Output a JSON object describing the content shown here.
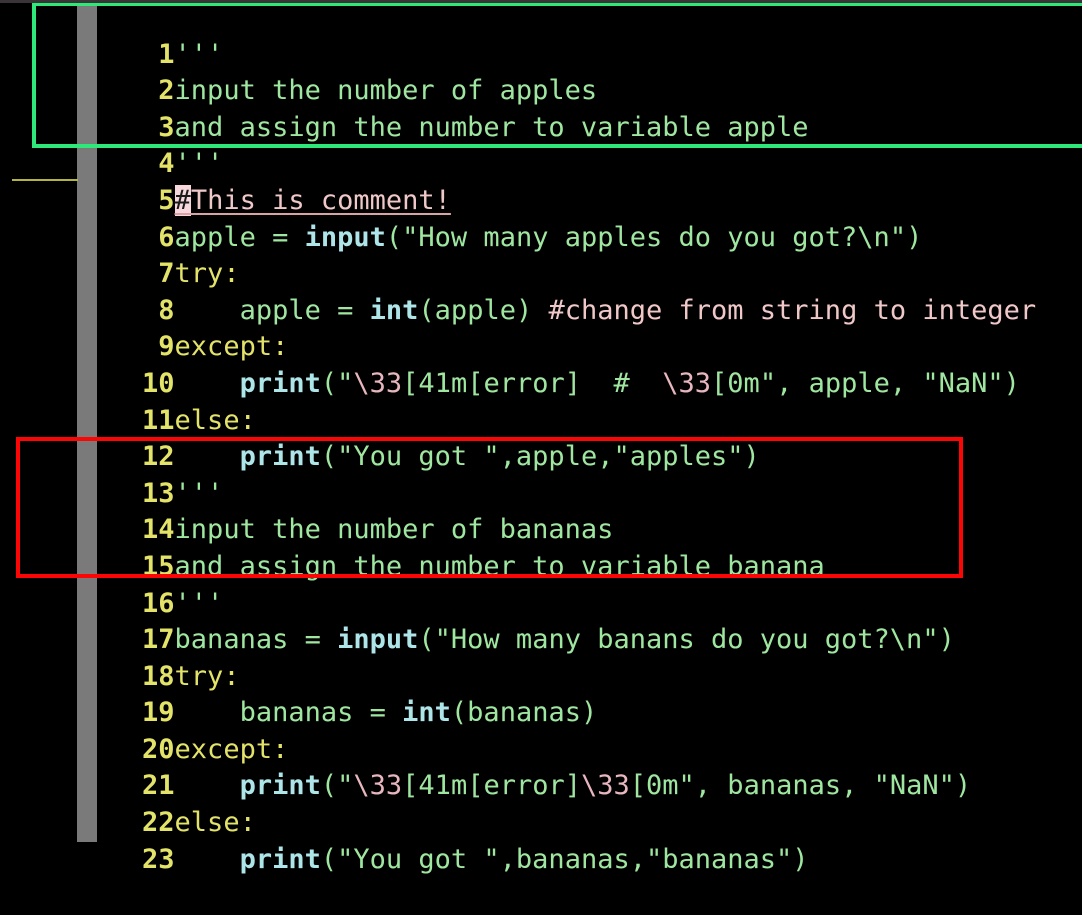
{
  "editor": {
    "language": "python",
    "background_color": "#000000",
    "line_number_color": "#e3e36a",
    "indent_guide_color": "#7a7a7a",
    "total_lines": 23
  },
  "annotations": [
    {
      "name": "green-highlight-box",
      "color": "#2ee87a",
      "covers_lines": "1-4",
      "label": "docstring-apples"
    },
    {
      "name": "red-highlight-box",
      "color": "#fb0505",
      "covers_lines": "13-16",
      "label": "docstring-bananas"
    }
  ],
  "lines": [
    {
      "num": "1",
      "text": "'''"
    },
    {
      "num": "2",
      "text": "input the number of apples"
    },
    {
      "num": "3",
      "text": "and assign the number to variable apple"
    },
    {
      "num": "4",
      "text": "'''"
    },
    {
      "num": "5",
      "text": "#This is comment!"
    },
    {
      "num": "6",
      "text": "apple = input(\"How many apples do you got?\\n\")"
    },
    {
      "num": "7",
      "text": "try:"
    },
    {
      "num": "8",
      "text": "    apple = int(apple) #change from string to integer"
    },
    {
      "num": "9",
      "text": "except:"
    },
    {
      "num": "10",
      "text": "    print(\"\\33[41m[error]  #  \\33[0m\", apple, \"NaN\")"
    },
    {
      "num": "11",
      "text": "else:"
    },
    {
      "num": "12",
      "text": "    print(\"You got \",apple,\"apples\")"
    },
    {
      "num": "13",
      "text": "'''"
    },
    {
      "num": "14",
      "text": "input the number of bananas"
    },
    {
      "num": "15",
      "text": "and assign the number to variable banana"
    },
    {
      "num": "16",
      "text": "'''"
    },
    {
      "num": "17",
      "text": "bananas = input(\"How many banans do you got?\\n\")"
    },
    {
      "num": "18",
      "text": "try:"
    },
    {
      "num": "19",
      "text": "    bananas = int(bananas)"
    },
    {
      "num": "20",
      "text": "except:"
    },
    {
      "num": "21",
      "text": "    print(\"\\33[41m[error]\\33[0m\", bananas, \"NaN\")"
    },
    {
      "num": "22",
      "text": "else:"
    },
    {
      "num": "23",
      "text": "    print(\"You got \",bananas,\"bananas\")"
    }
  ],
  "gutter": {
    "n1": "1",
    "n2": "2",
    "n3": "3",
    "n4": "4",
    "n5": "5",
    "n6": "6",
    "n7": "7",
    "n8": "8",
    "n9": "9",
    "n10": "10",
    "n11": "11",
    "n12": "12",
    "n13": "13",
    "n14": "14",
    "n15": "15",
    "n16": "16",
    "n17": "17",
    "n18": "18",
    "n19": "19",
    "n20": "20",
    "n21": "21",
    "n22": "22",
    "n23": "23"
  },
  "tokens": {
    "l1_quote": "'''",
    "l2_text": "input the number of apples",
    "l3_text": "and assign the number to variable apple",
    "l4_quote": "'''",
    "l5_hash": "#",
    "l5_text": "This is comment!",
    "l6_var": "apple ",
    "l6_eq": "= ",
    "l6_fn": "input",
    "l6_open": "(",
    "l6_str": "\"How many apples do you got?\\n\"",
    "l6_close": ")",
    "l7_kw": "try:",
    "l8_indent": "    ",
    "l8_var": "apple ",
    "l8_eq": "= ",
    "l8_fn": "int",
    "l8_args": "(apple) ",
    "l8_comment": "#change from string to integer",
    "l9_kw": "except:",
    "l10_indent": "    ",
    "l10_fn": "print",
    "l10_open": "(",
    "l10_q1": "\"",
    "l10_esc1": "\\33",
    "l10_mid": "[41m[error]  #  ",
    "l10_esc2": "\\33",
    "l10_tail": "[0m\"",
    "l10_rest": ", apple, \"NaN\")",
    "l11_kw": "else:",
    "l12_indent": "    ",
    "l12_fn": "print",
    "l12_rest": "(\"You got \",apple,\"apples\")",
    "l13_quote": "'''",
    "l14_text": "input the number of bananas",
    "l15_text": "and assign the number to variable banana",
    "l16_quote": "'''",
    "l17_var": "bananas ",
    "l17_eq": "= ",
    "l17_fn": "input",
    "l17_open": "(",
    "l17_str": "\"How many banans do you got?\\n\"",
    "l17_close": ")",
    "l18_kw": "try:",
    "l19_indent": "    ",
    "l19_var": "bananas ",
    "l19_eq": "= ",
    "l19_fn": "int",
    "l19_args": "(bananas)",
    "l20_kw": "except:",
    "l21_indent": "    ",
    "l21_fn": "print",
    "l21_open": "(",
    "l21_q1": "\"",
    "l21_esc1": "\\33",
    "l21_mid": "[41m[error]",
    "l21_esc2": "\\33",
    "l21_tail": "[0m\"",
    "l21_rest": ", bananas, \"NaN\")",
    "l22_kw": "else:",
    "l23_indent": "    ",
    "l23_fn": "print",
    "l23_rest": "(\"You got \",bananas,\"bananas\")"
  }
}
